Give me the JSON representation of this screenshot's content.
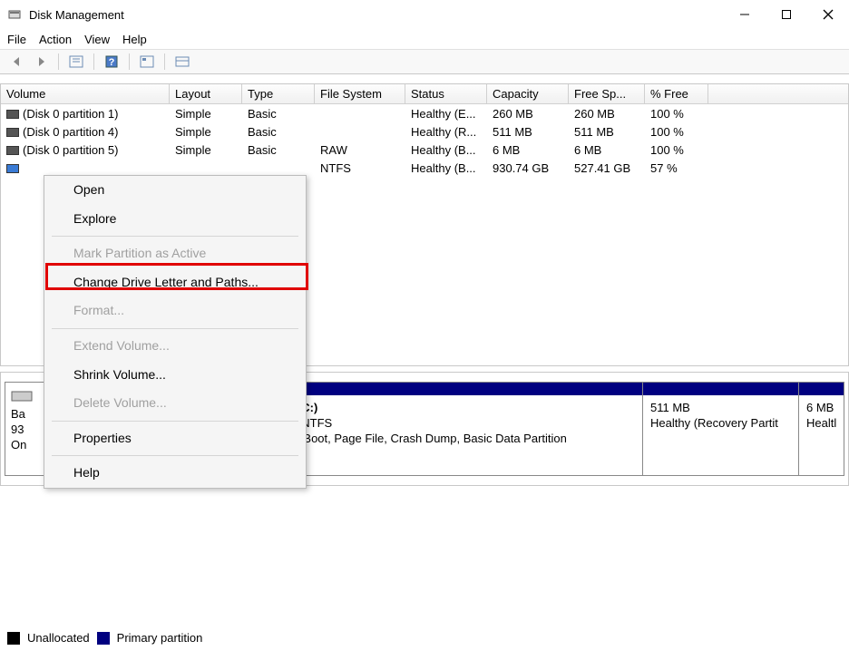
{
  "titlebar": {
    "title": "Disk Management"
  },
  "menubar": {
    "file": "File",
    "action": "Action",
    "view": "View",
    "help": "Help"
  },
  "volume_header": {
    "volume": "Volume",
    "layout": "Layout",
    "type": "Type",
    "fs": "File System",
    "status": "Status",
    "capacity": "Capacity",
    "free": "Free Sp...",
    "pctfree": "% Free"
  },
  "volumes": [
    {
      "name": "(Disk 0 partition 1)",
      "layout": "Simple",
      "type": "Basic",
      "fs": "",
      "status": "Healthy (E...",
      "capacity": "260 MB",
      "free": "260 MB",
      "pctfree": "100 %"
    },
    {
      "name": "(Disk 0 partition 4)",
      "layout": "Simple",
      "type": "Basic",
      "fs": "",
      "status": "Healthy (R...",
      "capacity": "511 MB",
      "free": "511 MB",
      "pctfree": "100 %"
    },
    {
      "name": "(Disk 0 partition 5)",
      "layout": "Simple",
      "type": "Basic",
      "fs": "RAW",
      "status": "Healthy (B...",
      "capacity": "6 MB",
      "free": "6 MB",
      "pctfree": "100 %"
    },
    {
      "name": "",
      "layout": "",
      "type": "",
      "fs": "NTFS",
      "status": "Healthy (B...",
      "capacity": "930.74 GB",
      "free": "527.41 GB",
      "pctfree": "57 %"
    }
  ],
  "disk_info": {
    "name_prefix": "Ba",
    "capacity_prefix": "93",
    "status_prefix": "On"
  },
  "partitions": {
    "p1": {
      "line1": "",
      "line2": "",
      "line3": ""
    },
    "p2": {
      "line1": "ows  (C:)",
      "line2": "4 GB NTFS",
      "line3": "althy (Boot, Page File, Crash Dump, Basic Data Partition"
    },
    "p3": {
      "line1": "",
      "line2": "511 MB",
      "line3": "Healthy (Recovery Partit"
    },
    "p4": {
      "line1": "",
      "line2": "6 MB",
      "line3": "Healtl"
    }
  },
  "context_menu": {
    "open": "Open",
    "explore": "Explore",
    "mark_active": "Mark Partition as Active",
    "change_drive": "Change Drive Letter and Paths...",
    "format": "Format...",
    "extend": "Extend Volume...",
    "shrink": "Shrink Volume...",
    "delete": "Delete Volume...",
    "properties": "Properties",
    "help": "Help"
  },
  "legend": {
    "unallocated": "Unallocated",
    "primary": "Primary partition"
  }
}
